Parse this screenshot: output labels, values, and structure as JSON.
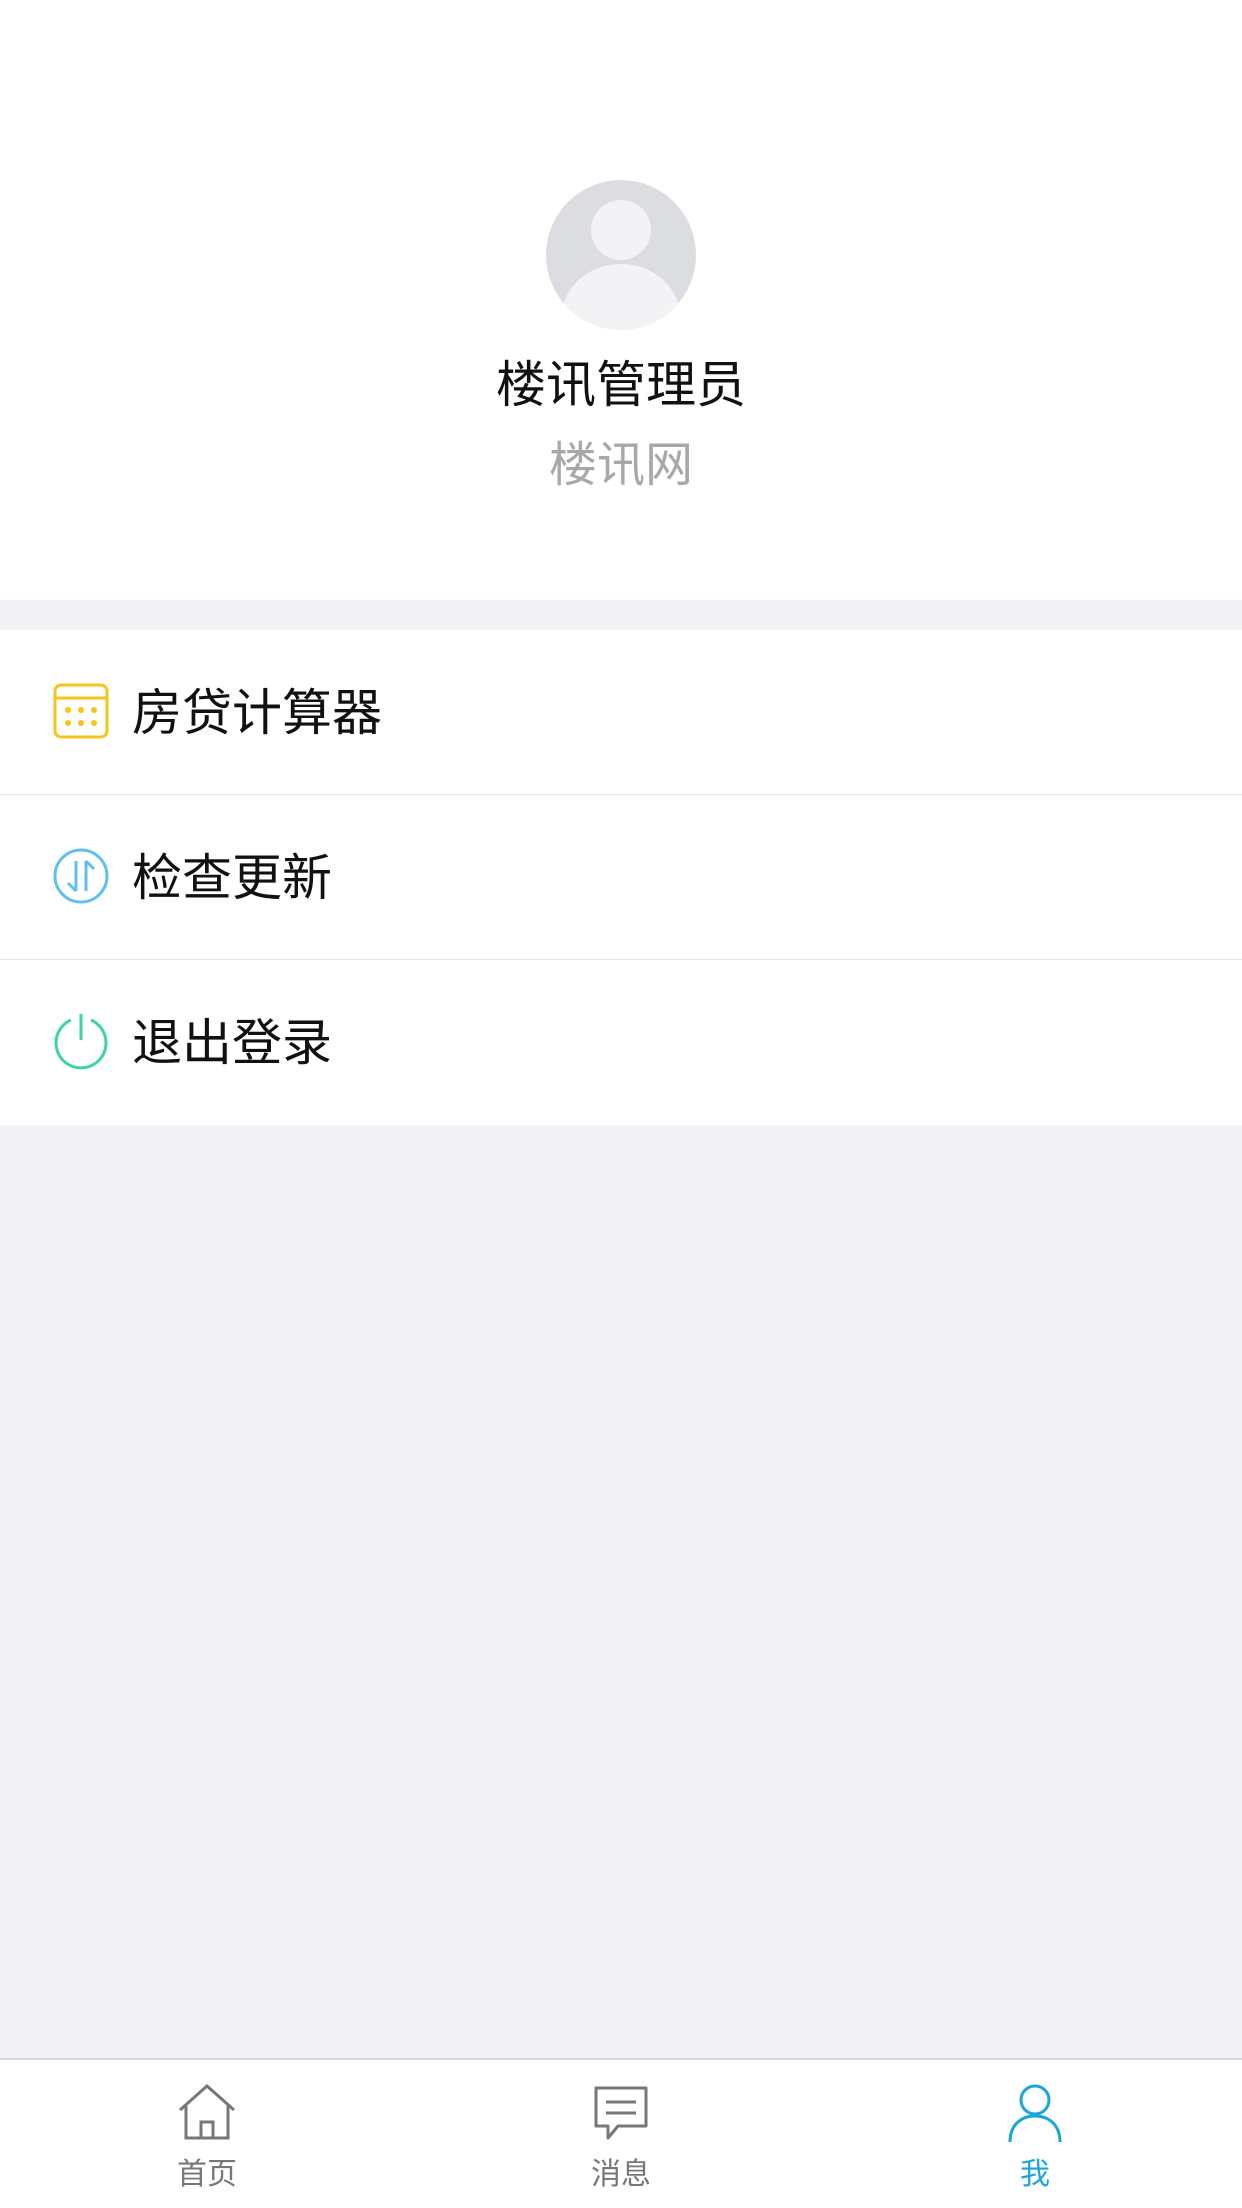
{
  "profile": {
    "name": "楼讯管理员",
    "organization": "楼讯网"
  },
  "menu": {
    "items": [
      {
        "label": "房贷计算器",
        "icon": "calculator-icon",
        "color": "#f5c518"
      },
      {
        "label": "检查更新",
        "icon": "update-icon",
        "color": "#5fc0f0"
      },
      {
        "label": "退出登录",
        "icon": "power-icon",
        "color": "#3fd1a8"
      }
    ]
  },
  "tabbar": {
    "tabs": [
      {
        "label": "首页",
        "icon": "home-icon",
        "active": false
      },
      {
        "label": "消息",
        "icon": "message-icon",
        "active": false
      },
      {
        "label": "我",
        "icon": "user-icon",
        "active": true
      }
    ],
    "active_color": "#1aa6d6",
    "inactive_color": "#777777"
  }
}
